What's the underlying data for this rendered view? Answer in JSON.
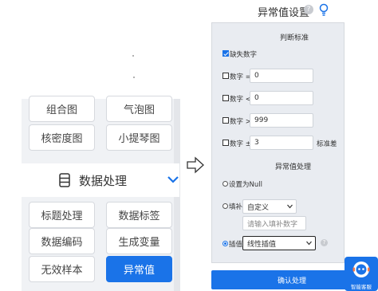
{
  "left_panel": {
    "row1": [
      "组合图",
      "气泡图"
    ],
    "row2": [
      "核密度图",
      "小提琴图"
    ],
    "section": {
      "label": "数据处理"
    },
    "row3": [
      "标题处理",
      "数据标签"
    ],
    "row4": [
      "数据编码",
      "生成变量"
    ],
    "row5": [
      "无效样本",
      "异常值"
    ]
  },
  "dialog": {
    "title": "异常值设置",
    "help_glyph": "?",
    "judge_title": "判断标准",
    "missing_label": "缺失数字",
    "eq_label": "数字 =",
    "eq_value": "0",
    "lt_label": "数字 <",
    "lt_value": "0",
    "gt_label": "数字 >",
    "gt_value": "999",
    "pm_label": "数字 ±",
    "pm_value": "3",
    "pm_unit": "标准差",
    "process_title": "异常值处理",
    "set_null_label": "设置为Null",
    "fill_label": "填补",
    "fill_select": "自定义",
    "fill_placeholder": "请输入填补数字",
    "interp_label": "插值",
    "interp_select": "线性插值",
    "confirm_label": "确认处理"
  },
  "assistant": {
    "label": "智能客服"
  },
  "colors": {
    "accent": "#1a73e8",
    "panel": "#e9ecf1"
  }
}
